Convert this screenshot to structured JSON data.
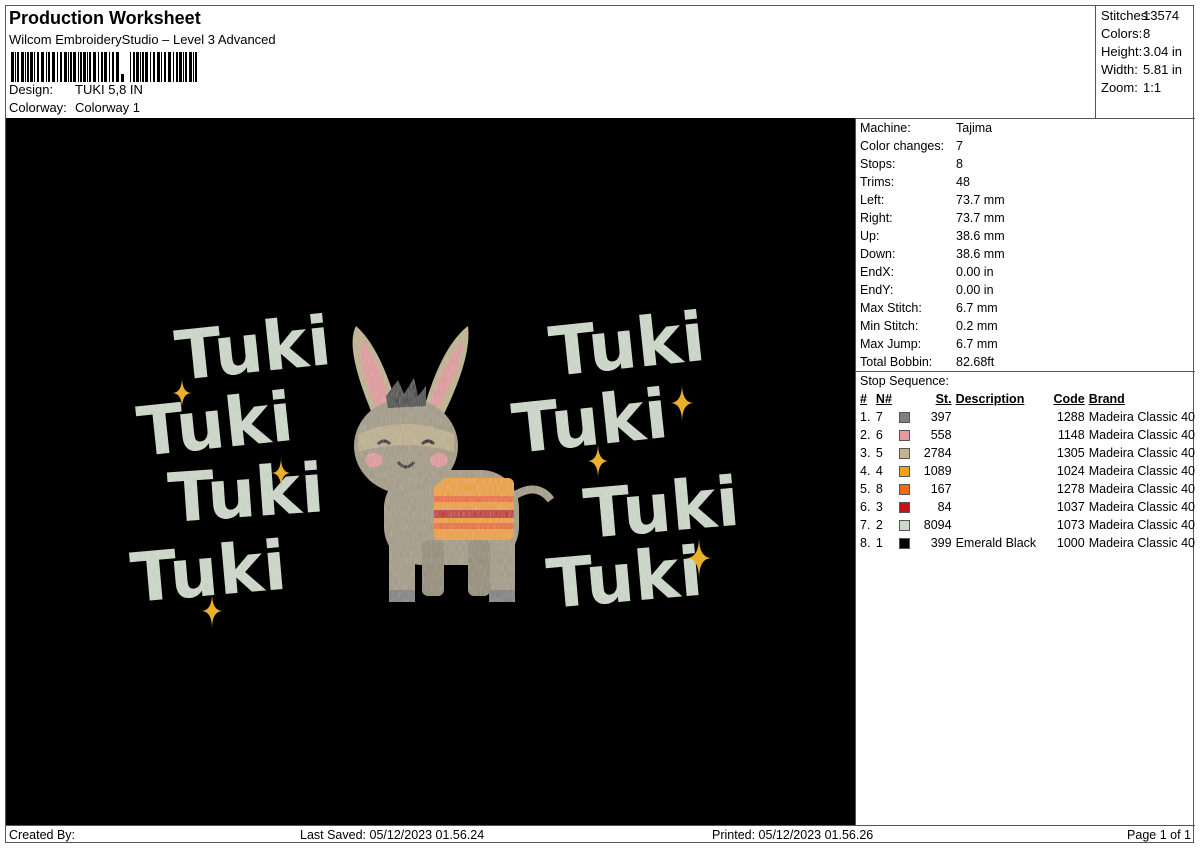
{
  "header": {
    "title": "Production Worksheet",
    "subtitle": "Wilcom EmbroideryStudio – Level 3 Advanced",
    "design_label": "Design:",
    "design_value": "TUKI 5,8 IN",
    "colorway_label": "Colorway:",
    "colorway_value": "Colorway 1"
  },
  "stats": [
    {
      "label": "Stitches:",
      "value": "13574"
    },
    {
      "label": "Colors:",
      "value": "8"
    },
    {
      "label": "Height:",
      "value": "3.04 in"
    },
    {
      "label": "Width:",
      "value": "5.81 in"
    },
    {
      "label": "Zoom:",
      "value": "1:1"
    }
  ],
  "machine": [
    {
      "label": "Machine:",
      "value": "Tajima"
    },
    {
      "label": "Color changes:",
      "value": "7"
    },
    {
      "label": "Stops:",
      "value": "8"
    },
    {
      "label": "Trims:",
      "value": "48"
    },
    {
      "label": "Left:",
      "value": "73.7 mm"
    },
    {
      "label": "Right:",
      "value": "73.7 mm"
    },
    {
      "label": "Up:",
      "value": "38.6 mm"
    },
    {
      "label": "Down:",
      "value": "38.6 mm"
    },
    {
      "label": "EndX:",
      "value": "0.00 in"
    },
    {
      "label": "EndY:",
      "value": "0.00 in"
    },
    {
      "label": "Max Stitch:",
      "value": "6.7 mm"
    },
    {
      "label": "Min Stitch:",
      "value": "0.2 mm"
    },
    {
      "label": "Max Jump:",
      "value": "6.7 mm"
    },
    {
      "label": "Total Bobbin:",
      "value": "82.68ft"
    }
  ],
  "stop_sequence": {
    "title": "Stop Sequence:",
    "columns": [
      "#",
      "N#",
      "St.",
      "Description",
      "Code",
      "Brand"
    ],
    "rows": [
      {
        "num": "1.",
        "n": "7",
        "color": "#7f7f7f",
        "st": "397",
        "desc": "",
        "code": "1288",
        "brand": "Madeira Classic 40"
      },
      {
        "num": "2.",
        "n": "6",
        "color": "#e49a9e",
        "st": "558",
        "desc": "",
        "code": "1148",
        "brand": "Madeira Classic 40"
      },
      {
        "num": "3.",
        "n": "5",
        "color": "#c3b48e",
        "st": "2784",
        "desc": "",
        "code": "1305",
        "brand": "Madeira Classic 40"
      },
      {
        "num": "4.",
        "n": "4",
        "color": "#f2a11a",
        "st": "1089",
        "desc": "",
        "code": "1024",
        "brand": "Madeira Classic 40"
      },
      {
        "num": "5.",
        "n": "8",
        "color": "#f06a16",
        "st": "167",
        "desc": "",
        "code": "1278",
        "brand": "Madeira Classic 40"
      },
      {
        "num": "6.",
        "n": "3",
        "color": "#c3131b",
        "st": "84",
        "desc": "",
        "code": "1037",
        "brand": "Madeira Classic 40"
      },
      {
        "num": "7.",
        "n": "2",
        "color": "#ccd8cc",
        "st": "8094",
        "desc": "",
        "code": "1073",
        "brand": "Madeira Classic 40"
      },
      {
        "num": "8.",
        "n": "1",
        "color": "#000000",
        "st": "399",
        "desc": "Emerald Black",
        "code": "1000",
        "brand": "Madeira Classic 40"
      }
    ]
  },
  "design": {
    "word": "Tuki",
    "text_color": "#cfdccc",
    "sparkle_color": "#e8b02c",
    "body_color": "#a59b84",
    "blanket_colors": [
      "#f2a11a",
      "#f06a16",
      "#c3131b"
    ]
  },
  "footer": {
    "created_by": "Created By:",
    "last_saved": "Last Saved: 05/12/2023 01.56.24",
    "printed": "Printed: 05/12/2023 01.56.26",
    "page": "Page 1 of 1"
  }
}
